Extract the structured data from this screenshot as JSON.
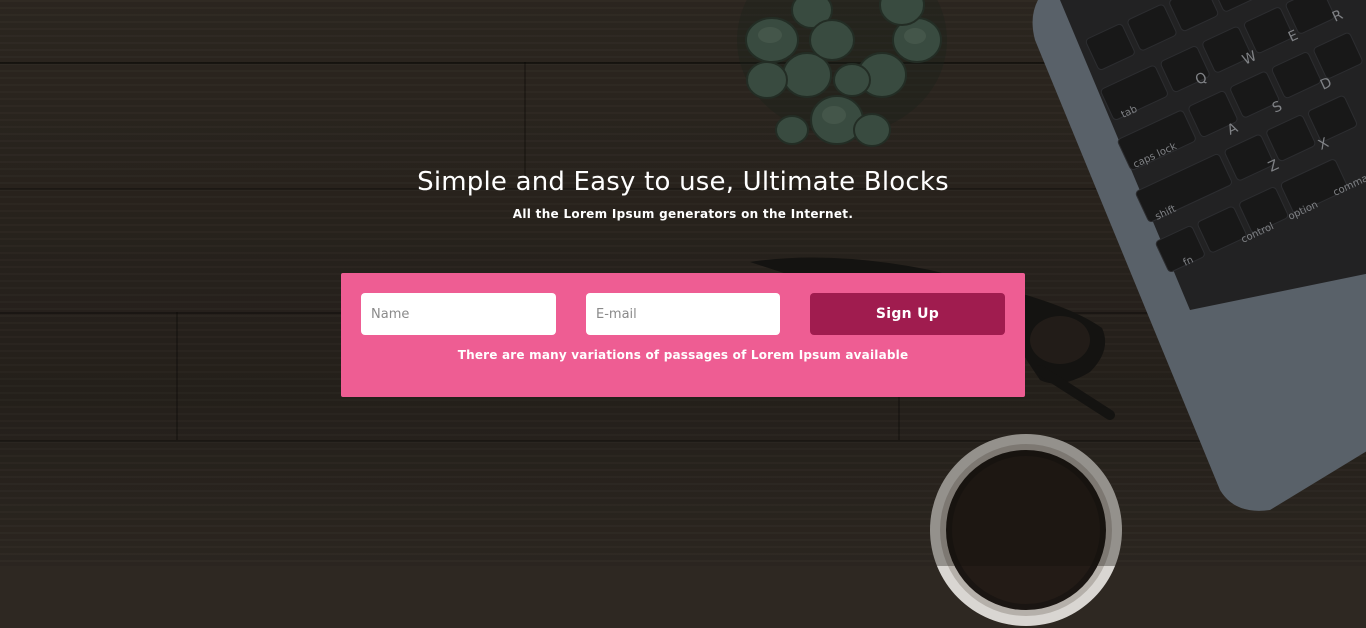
{
  "hero": {
    "title": "Simple and Easy to use, Ultimate Blocks",
    "subtitle": "All the Lorem Ipsum generators on the Internet."
  },
  "signup_form": {
    "name_placeholder": "Name",
    "email_placeholder": "E-mail",
    "submit_label": "Sign Up",
    "note": "There are many variations of passages of Lorem Ipsum available"
  },
  "colors": {
    "form_background": "#ee5d93",
    "button_background": "#a01c4f"
  },
  "laptop_keys": [
    "tab",
    "caps lock",
    "shift",
    "fn",
    "control",
    "option",
    "command",
    "Q",
    "W",
    "E",
    "R",
    "A",
    "S",
    "D",
    "Z",
    "X"
  ]
}
